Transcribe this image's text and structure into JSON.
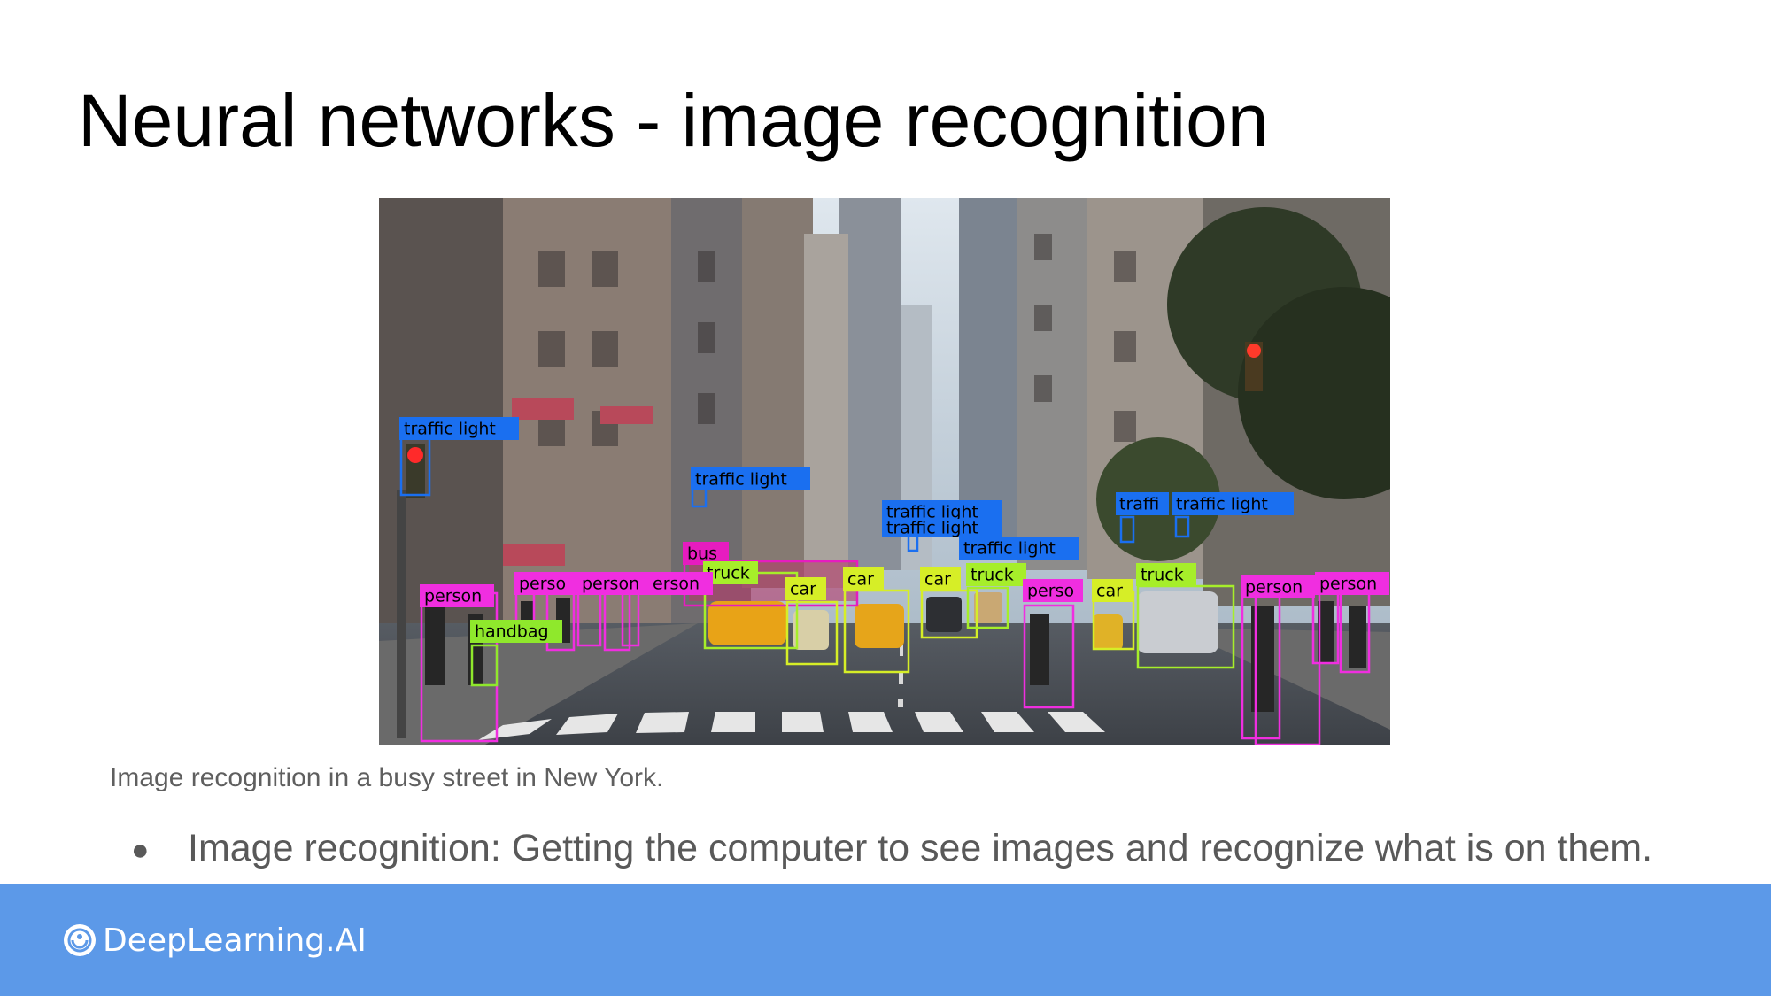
{
  "slide": {
    "title": "Neural networks - image recognition",
    "caption": "Image recognition in a busy street in New York.",
    "bullets": [
      "Image recognition: Getting the computer to see images and recognize what is on them."
    ]
  },
  "image": {
    "subject": "street-detection-photo",
    "detections": [
      {
        "label": "traffic light",
        "color": "#1a6ff0"
      },
      {
        "label": "traffic light",
        "color": "#1a6ff0"
      },
      {
        "label": "traffic light",
        "color": "#1a6ff0"
      },
      {
        "label": "traffic light",
        "color": "#1a6ff0"
      },
      {
        "label": "traffic light",
        "color": "#1a6ff0"
      },
      {
        "label": "traffi",
        "color": "#1a6ff0"
      },
      {
        "label": "traffic light",
        "color": "#1a6ff0"
      },
      {
        "label": "bus",
        "color": "#e61cbf"
      },
      {
        "label": "truck",
        "color": "#a6ee2a"
      },
      {
        "label": "car",
        "color": "#d6ee27"
      },
      {
        "label": "car",
        "color": "#d6ee27"
      },
      {
        "label": "car",
        "color": "#d6ee27"
      },
      {
        "label": "truck",
        "color": "#a6ee2a"
      },
      {
        "label": "car",
        "color": "#d6ee27"
      },
      {
        "label": "truck",
        "color": "#a6ee2a"
      },
      {
        "label": "person",
        "color": "#f02ee0"
      },
      {
        "label": "handbag",
        "color": "#8fe82c"
      },
      {
        "label": "perso",
        "color": "#f02ee0"
      },
      {
        "label": "person",
        "color": "#f02ee0"
      },
      {
        "label": "erson",
        "color": "#f02ee0"
      },
      {
        "label": "perso",
        "color": "#f02ee0"
      },
      {
        "label": "person",
        "color": "#f02ee0"
      },
      {
        "label": "person",
        "color": "#f02ee0"
      }
    ]
  },
  "footer": {
    "brand": "DeepLearning.AI",
    "background": "#5c99e8"
  }
}
